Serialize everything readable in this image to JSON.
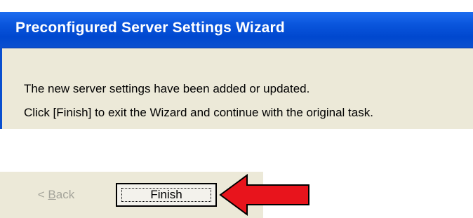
{
  "wizard": {
    "title": "Preconfigured Server Settings Wizard",
    "message_line1": "The new server settings have been added or updated.",
    "message_line2": "Click [Finish] to exit the Wizard and continue with the original task."
  },
  "buttons": {
    "back_prefix": "< ",
    "back_mnemonic": "B",
    "back_rest": "ack",
    "finish_label": "Finish"
  },
  "annotation": {
    "arrow_icon": "red-arrow-left-icon",
    "arrow_color": "#e8141c",
    "title_bar_color": "#0048cf",
    "panel_color": "#ece9d8"
  }
}
